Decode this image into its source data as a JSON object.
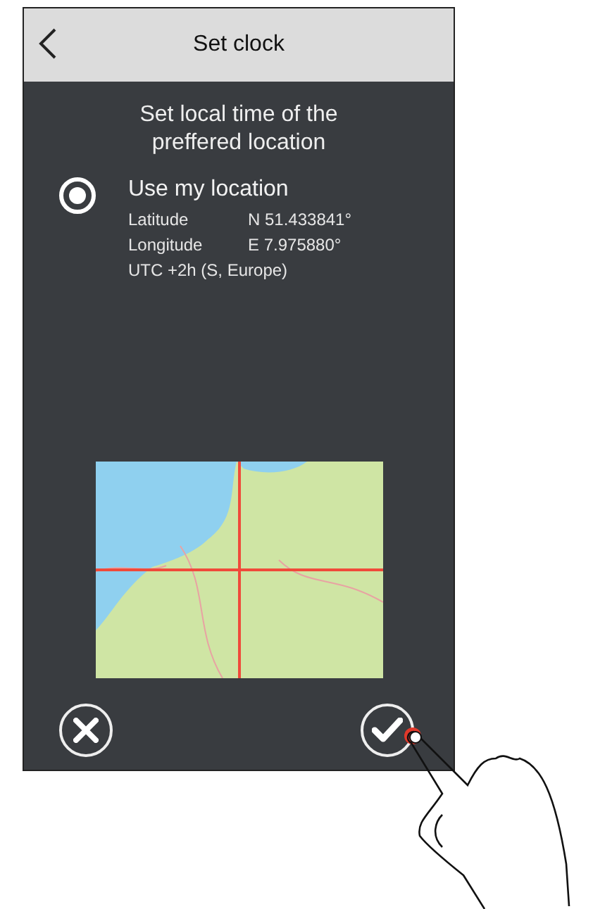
{
  "header": {
    "title": "Set clock"
  },
  "heading": "Set local time of the\npreffered location",
  "option": {
    "label": "Use my location",
    "selected": true,
    "rows": [
      {
        "label": "Latitude",
        "value": "N 51.433841°"
      },
      {
        "label": "Longitude",
        "value": "E 7.975880°"
      }
    ],
    "timezone": "UTC +2h  (S, Europe)"
  }
}
